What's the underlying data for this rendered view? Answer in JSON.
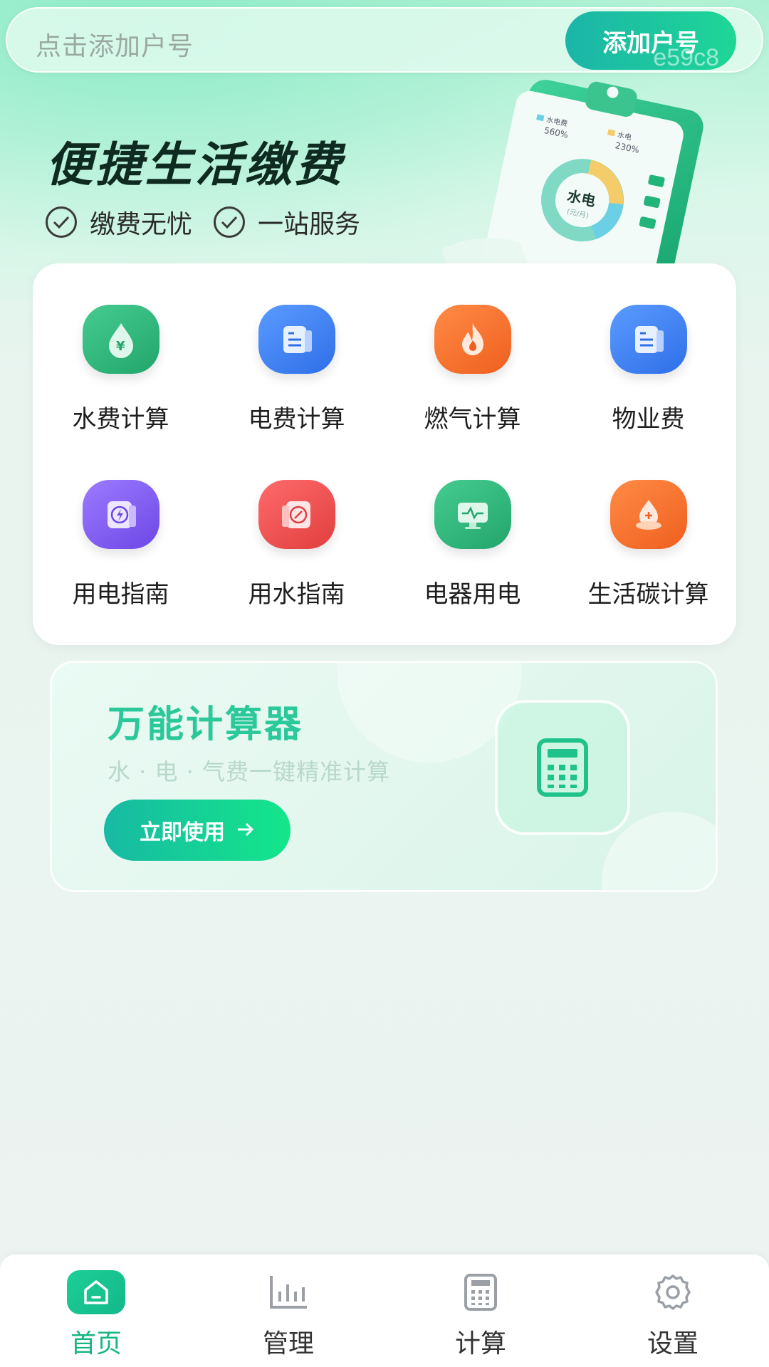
{
  "search": {
    "placeholder": "点击添加户号",
    "add_button": "添加户号",
    "watermark": "e59c8"
  },
  "hero": {
    "title": "便捷生活缴费",
    "tags": [
      "缴费无忧",
      "一站服务"
    ],
    "illustration": {
      "legend": [
        {
          "label": "水电费",
          "value": "560%"
        },
        {
          "label": "水电",
          "value": "230%"
        }
      ],
      "donut_label": "水电",
      "donut_sub": "(元/月)"
    }
  },
  "grid": {
    "items": [
      {
        "label": "水费计算",
        "icon": "water-drop-icon",
        "color": "#2fb57d"
      },
      {
        "label": "电费计算",
        "icon": "electric-bill-icon",
        "color": "#3f82f4"
      },
      {
        "label": "燃气计算",
        "icon": "flame-icon",
        "color": "#f5742c"
      },
      {
        "label": "物业费",
        "icon": "property-bill-icon",
        "color": "#3f82f4"
      },
      {
        "label": "用电指南",
        "icon": "lightning-guide-icon",
        "color": "#8a63ee"
      },
      {
        "label": "用水指南",
        "icon": "water-guide-icon",
        "color": "#ee4f4f"
      },
      {
        "label": "电器用电",
        "icon": "appliance-monitor-icon",
        "color": "#2fb57d"
      },
      {
        "label": "生活碳计算",
        "icon": "carbon-icon",
        "color": "#f5742c"
      }
    ]
  },
  "promo": {
    "title": "万能计算器",
    "subtitle": "水 · 电 · 气费一键精准计算",
    "button": "立即使用",
    "icon": "calculator-icon"
  },
  "nav": {
    "items": [
      {
        "label": "首页",
        "icon": "home-icon",
        "active": true
      },
      {
        "label": "管理",
        "icon": "bar-chart-icon",
        "active": false
      },
      {
        "label": "计算",
        "icon": "calculator-icon",
        "active": false
      },
      {
        "label": "设置",
        "icon": "gear-icon",
        "active": false
      }
    ]
  },
  "colors": {
    "accent": "#18b583",
    "title_dark": "#0f2a20",
    "promo_title": "#2bc89a"
  }
}
